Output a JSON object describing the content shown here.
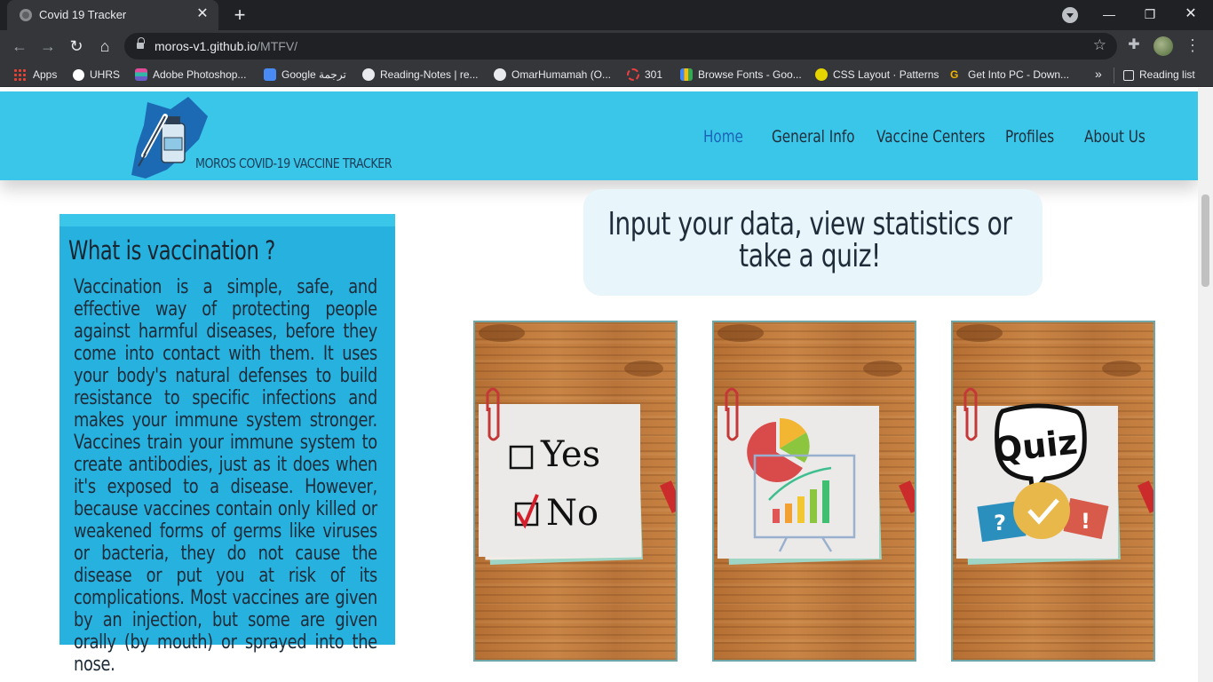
{
  "browser": {
    "tab_title": "Covid 19 Tracker",
    "url_host": "moros-v1.github.io",
    "url_path": "/MTFV/",
    "bookmarks": [
      "Apps",
      "UHRS",
      "Adobe Photoshop...",
      "Google ترجمة",
      "Reading-Notes | re...",
      "OmarHumamah (O...",
      "301",
      "Browse Fonts - Goo...",
      "CSS Layout · Patterns",
      "Get Into PC - Down..."
    ],
    "bookmarks_overflow": "»",
    "reading_list": "Reading list"
  },
  "site": {
    "title": "MOROS COVID-19 VACCINE TRACKER",
    "nav": [
      "Home",
      "General Info",
      "Vaccine Centers",
      "Profiles",
      "About Us"
    ],
    "active_nav": "Home",
    "accent_color": "#39c6e8"
  },
  "info": {
    "title": "What is vaccination ?",
    "body": "Vaccination is a simple, safe, and effective way of protecting people against harmful diseases, before they come into contact with them. It uses your body's natural defenses to build resistance to specific infections and makes your immune system stronger. Vaccines train your immune system to create antibodies, just as it does when it's exposed to a disease. However, because vaccines contain only killed or weakened forms of germs like viruses or bacteria, they do not cause the disease or put you at risk of its complications. Most vaccines are given by an injection, but some are given orally (by mouth) or sprayed into the nose."
  },
  "cta": {
    "text": "Input your data, view statistics or take a quiz!"
  },
  "cards": {
    "input": {
      "yes_label": "Yes",
      "no_label": "No"
    },
    "stats": {
      "icon": "chart-presentation-icon"
    },
    "quiz": {
      "label": "Quiz",
      "question_mark": "?",
      "exclamation": "!"
    }
  }
}
